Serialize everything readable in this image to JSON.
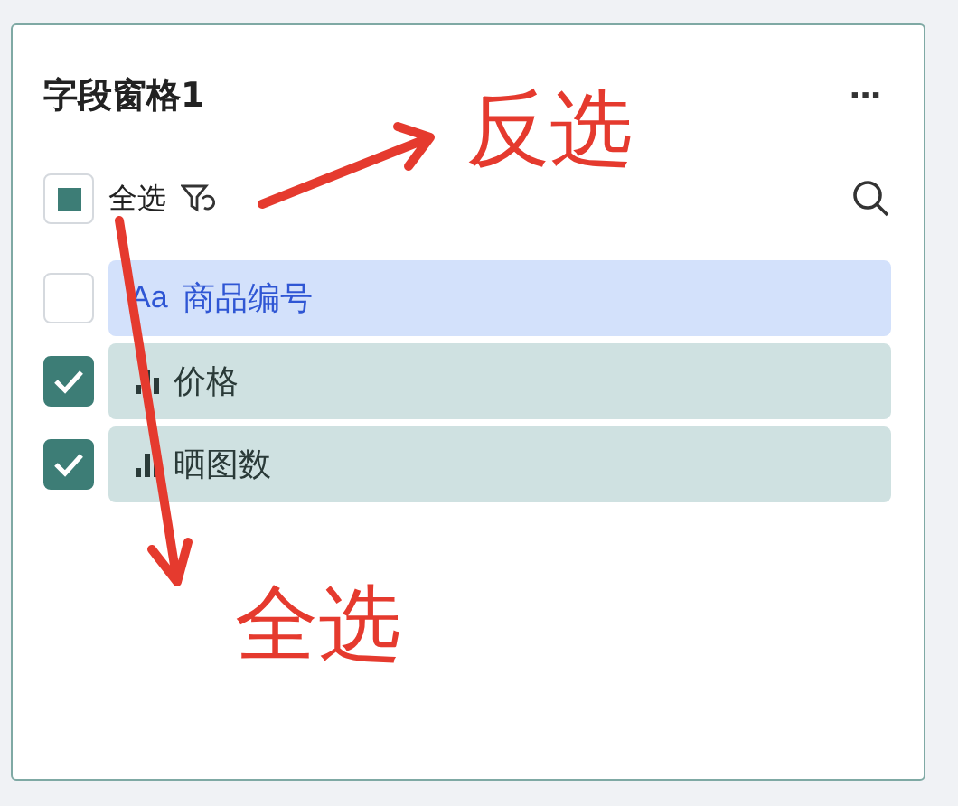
{
  "panel": {
    "title": "字段窗格1",
    "menu": "···"
  },
  "select_all": {
    "label": "全选",
    "partial": true
  },
  "fields": [
    {
      "name": "商品编号",
      "kind": "dimension",
      "type_icon": "Aa",
      "checked": false
    },
    {
      "name": "价格",
      "kind": "measure",
      "checked": true
    },
    {
      "name": "晒图数",
      "kind": "measure",
      "checked": true
    }
  ],
  "annotations": [
    {
      "text": "反选"
    },
    {
      "text": "全选"
    }
  ]
}
